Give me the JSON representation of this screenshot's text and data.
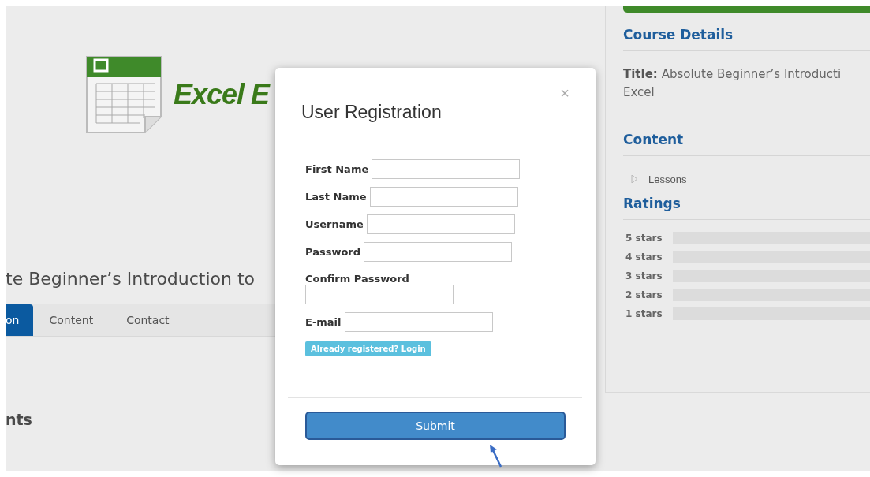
{
  "logo": {
    "text": "Excel E"
  },
  "course_title": "te Beginner’s Introduction to",
  "tabs": [
    {
      "label": "on",
      "selected": true
    },
    {
      "label": "Content",
      "selected": false
    },
    {
      "label": "Contact",
      "selected": false
    }
  ],
  "section_heading": "nts",
  "sidebar": {
    "details_heading": "Course Details",
    "title_label": "Title:",
    "title_value": "Absolute Beginner’s Introducti",
    "title_value_line2": "Excel",
    "content_heading": "Content",
    "lessons": {
      "label": "Lessons",
      "expanded": false
    },
    "ratings_heading": "Ratings",
    "ratings": [
      {
        "label": "5 stars"
      },
      {
        "label": "4 stars"
      },
      {
        "label": "3 stars"
      },
      {
        "label": "2 stars"
      },
      {
        "label": "1 stars"
      }
    ]
  },
  "modal": {
    "title": "User Registration",
    "close": "×",
    "fields": [
      {
        "label": "First Name",
        "kind": "inline"
      },
      {
        "label": "Last Name",
        "kind": "inline"
      },
      {
        "label": "Username",
        "kind": "inline"
      },
      {
        "label": "Password",
        "kind": "inline"
      },
      {
        "label": "Confirm Password",
        "kind": "stacked"
      },
      {
        "label": "E-mail",
        "kind": "inline"
      }
    ],
    "login_link": "Already registered? Login",
    "submit": "Submit"
  }
}
